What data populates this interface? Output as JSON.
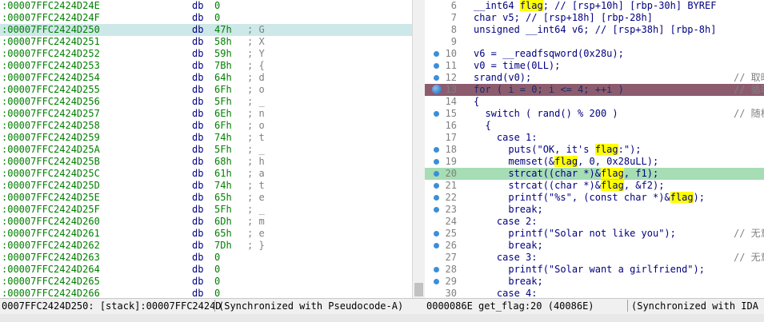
{
  "hex_view": {
    "rows": [
      {
        "addr": ":00007FFC2424D24E",
        "op": "db",
        "val": "0",
        "cmt": ""
      },
      {
        "addr": ":00007FFC2424D24F",
        "op": "db",
        "val": "0",
        "cmt": ""
      },
      {
        "addr": ":00007FFC2424D250",
        "op": "db",
        "val": "47h",
        "cmt": "; G",
        "selected": true
      },
      {
        "addr": ":00007FFC2424D251",
        "op": "db",
        "val": "58h",
        "cmt": "; X"
      },
      {
        "addr": ":00007FFC2424D252",
        "op": "db",
        "val": "59h",
        "cmt": "; Y"
      },
      {
        "addr": ":00007FFC2424D253",
        "op": "db",
        "val": "7Bh",
        "cmt": "; {"
      },
      {
        "addr": ":00007FFC2424D254",
        "op": "db",
        "val": "64h",
        "cmt": "; d"
      },
      {
        "addr": ":00007FFC2424D255",
        "op": "db",
        "val": "6Fh",
        "cmt": "; o"
      },
      {
        "addr": ":00007FFC2424D256",
        "op": "db",
        "val": "5Fh",
        "cmt": "; _"
      },
      {
        "addr": ":00007FFC2424D257",
        "op": "db",
        "val": "6Eh",
        "cmt": "; n"
      },
      {
        "addr": ":00007FFC2424D258",
        "op": "db",
        "val": "6Fh",
        "cmt": "; o"
      },
      {
        "addr": ":00007FFC2424D259",
        "op": "db",
        "val": "74h",
        "cmt": "; t"
      },
      {
        "addr": ":00007FFC2424D25A",
        "op": "db",
        "val": "5Fh",
        "cmt": "; _"
      },
      {
        "addr": ":00007FFC2424D25B",
        "op": "db",
        "val": "68h",
        "cmt": "; h"
      },
      {
        "addr": ":00007FFC2424D25C",
        "op": "db",
        "val": "61h",
        "cmt": "; a"
      },
      {
        "addr": ":00007FFC2424D25D",
        "op": "db",
        "val": "74h",
        "cmt": "; t"
      },
      {
        "addr": ":00007FFC2424D25E",
        "op": "db",
        "val": "65h",
        "cmt": "; e"
      },
      {
        "addr": ":00007FFC2424D25F",
        "op": "db",
        "val": "5Fh",
        "cmt": "; _"
      },
      {
        "addr": ":00007FFC2424D260",
        "op": "db",
        "val": "6Dh",
        "cmt": "; m"
      },
      {
        "addr": ":00007FFC2424D261",
        "op": "db",
        "val": "65h",
        "cmt": "; e"
      },
      {
        "addr": ":00007FFC2424D262",
        "op": "db",
        "val": "7Dh",
        "cmt": "; }"
      },
      {
        "addr": ":00007FFC2424D263",
        "op": "db",
        "val": "0",
        "cmt": ""
      },
      {
        "addr": ":00007FFC2424D264",
        "op": "db",
        "val": "0",
        "cmt": ""
      },
      {
        "addr": ":00007FFC2424D265",
        "op": "db",
        "val": "0",
        "cmt": ""
      },
      {
        "addr": ":00007FFC2424D266",
        "op": "db",
        "val": "0",
        "cmt": ""
      }
    ],
    "status_addr": "0007FFC2424D250: [stack]:00007FFC2424D",
    "status_sync": "(Synchronized with Pseudocode-A)"
  },
  "pseudocode": {
    "lines": [
      {
        "no": "6",
        "text": "__int64 flag; // [rsp+10h] [rbp-30h] BYREF",
        "bp": false
      },
      {
        "no": "7",
        "text": "char v5; // [rsp+18h] [rbp-28h]",
        "bp": false
      },
      {
        "no": "8",
        "text": "unsigned __int64 v6; // [rsp+38h] [rbp-8h]",
        "bp": false
      },
      {
        "no": "9",
        "text": "",
        "bp": false
      },
      {
        "no": "10",
        "text": "v6 = __readfsqword(0x28u);",
        "bp": true
      },
      {
        "no": "11",
        "text": "v0 = time(0LL);",
        "bp": true
      },
      {
        "no": "12",
        "text": "srand(v0);",
        "bp": true,
        "comment": "// 取时"
      },
      {
        "no": "13",
        "text": "for ( i = 0; i <= 4; ++i )",
        "bp": true,
        "big": true,
        "comment": "// 循环"
      },
      {
        "no": "14",
        "text": "{",
        "bp": false
      },
      {
        "no": "15",
        "text": "  switch ( rand() % 200 )",
        "bp": true,
        "comment": "// 随机"
      },
      {
        "no": "16",
        "text": "  {",
        "bp": false
      },
      {
        "no": "17",
        "text": "    case 1:",
        "bp": false
      },
      {
        "no": "18",
        "text": "      puts(\"OK, it's flag:\");",
        "bp": true
      },
      {
        "no": "19",
        "text": "      memset(&flag, 0, 0x28uLL);",
        "bp": true
      },
      {
        "no": "20",
        "text": "      strcat((char *)&flag, f1);",
        "bp": true
      },
      {
        "no": "21",
        "text": "      strcat((char *)&flag, &f2);",
        "bp": true
      },
      {
        "no": "22",
        "text": "      printf(\"%s\", (const char *)&flag);",
        "bp": true
      },
      {
        "no": "23",
        "text": "      break;",
        "bp": true
      },
      {
        "no": "24",
        "text": "    case 2:",
        "bp": false
      },
      {
        "no": "25",
        "text": "      printf(\"Solar not like you\");",
        "bp": true,
        "comment": "// 无意"
      },
      {
        "no": "26",
        "text": "      break;",
        "bp": true
      },
      {
        "no": "27",
        "text": "    case 3:",
        "bp": false,
        "comment": "// 无意"
      },
      {
        "no": "28",
        "text": "      printf(\"Solar want a girlfriend\");",
        "bp": true
      },
      {
        "no": "29",
        "text": "      break;",
        "bp": true
      },
      {
        "no": "30",
        "text": "    case 4:",
        "bp": false
      }
    ],
    "status_addr": "0000086E get_flag:20 (40086E)",
    "status_sync": "(Synchronized with IDA V"
  }
}
